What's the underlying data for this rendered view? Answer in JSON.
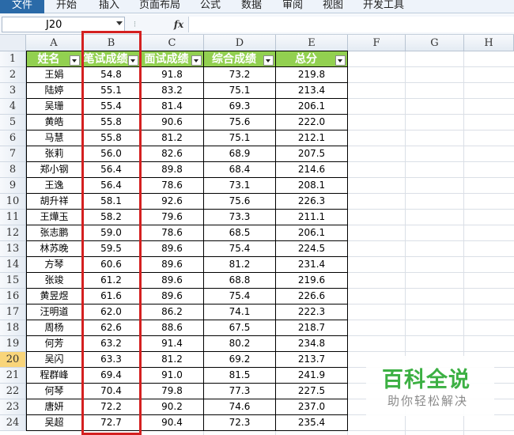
{
  "ribbon": {
    "tabs": [
      "文件",
      "开始",
      "插入",
      "页面布局",
      "公式",
      "数据",
      "审阅",
      "视图",
      "开发工具"
    ]
  },
  "formula_bar": {
    "name_box": "J20",
    "fx_label": "fx",
    "formula": ""
  },
  "grid": {
    "columns": [
      "A",
      "B",
      "C",
      "D",
      "E",
      "F",
      "G",
      "H"
    ],
    "rows": [
      "1",
      "2",
      "3",
      "4",
      "5",
      "6",
      "7",
      "8",
      "9",
      "10",
      "11",
      "12",
      "13",
      "14",
      "15",
      "16",
      "17",
      "18",
      "19",
      "20",
      "21",
      "22",
      "23",
      "24"
    ],
    "selected_row": "20",
    "header": [
      "姓名",
      "笔试成绩",
      "面试成绩",
      "综合成绩",
      "总分"
    ],
    "data": [
      [
        "王娟",
        "54.8",
        "91.8",
        "73.2",
        "219.8"
      ],
      [
        "陆婷",
        "55.1",
        "83.2",
        "75.1",
        "213.4"
      ],
      [
        "吴珊",
        "55.4",
        "81.4",
        "69.3",
        "206.1"
      ],
      [
        "黄皓",
        "55.8",
        "90.6",
        "75.6",
        "222.0"
      ],
      [
        "马慧",
        "55.8",
        "81.2",
        "75.1",
        "212.1"
      ],
      [
        "张莉",
        "56.0",
        "82.6",
        "68.9",
        "207.5"
      ],
      [
        "郑小钢",
        "56.4",
        "89.8",
        "68.4",
        "214.6"
      ],
      [
        "王逸",
        "56.4",
        "78.6",
        "73.1",
        "208.1"
      ],
      [
        "胡升祥",
        "58.1",
        "92.6",
        "75.6",
        "226.3"
      ],
      [
        "王燁玉",
        "58.2",
        "79.6",
        "73.3",
        "211.1"
      ],
      [
        "张志鹏",
        "59.0",
        "78.6",
        "68.5",
        "206.1"
      ],
      [
        "林苏晚",
        "59.5",
        "89.6",
        "75.4",
        "224.5"
      ],
      [
        "方琴",
        "60.6",
        "89.6",
        "81.2",
        "231.4"
      ],
      [
        "张竣",
        "61.2",
        "89.6",
        "68.8",
        "219.6"
      ],
      [
        "黄昱煜",
        "61.6",
        "89.6",
        "75.4",
        "226.6"
      ],
      [
        "汪明道",
        "62.0",
        "86.2",
        "74.1",
        "222.3"
      ],
      [
        "周杨",
        "62.6",
        "88.6",
        "67.5",
        "218.7"
      ],
      [
        "何芳",
        "63.2",
        "91.4",
        "80.2",
        "234.8"
      ],
      [
        "吴闪",
        "63.3",
        "81.2",
        "69.2",
        "213.7"
      ],
      [
        "程群峰",
        "69.4",
        "91.0",
        "81.5",
        "241.9"
      ],
      [
        "何琴",
        "70.4",
        "79.8",
        "77.3",
        "227.5"
      ],
      [
        "唐妍",
        "72.2",
        "90.2",
        "74.6",
        "237.0"
      ],
      [
        "吴超",
        "72.7",
        "90.4",
        "72.3",
        "235.4"
      ]
    ]
  },
  "watermark": {
    "title": "百科全说",
    "subtitle": "助你轻松解决"
  },
  "colors": {
    "header_fill": "#92d050",
    "highlight": "#d42020",
    "watermark": "#3cb043"
  }
}
